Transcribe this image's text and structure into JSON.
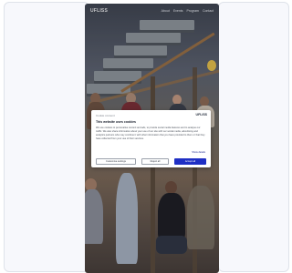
{
  "page": {
    "app_title": "UFLISS",
    "nav_links": [
      "About",
      "Events",
      "Program",
      "Contact"
    ]
  },
  "consent": {
    "brand_label": "Cookie consent",
    "logo_text": "UFLISS",
    "title": "This website uses cookies",
    "body": "We use cookies to personalise content and ads, to provide social media features and to analyse our traffic. We also share information about your use of our site with our social media, advertising and analytics partners who may combine it with other information that you have provided to them or that they have collected from your use of their services.",
    "details_link": "Show details",
    "buttons": {
      "settings": "Customise settings",
      "reject": "Reject all",
      "accept": "Accept all"
    }
  },
  "colors": {
    "accent": "#1f2fc4",
    "panel_bg": "#f7f8fc",
    "panel_border": "#dfe3ea"
  }
}
